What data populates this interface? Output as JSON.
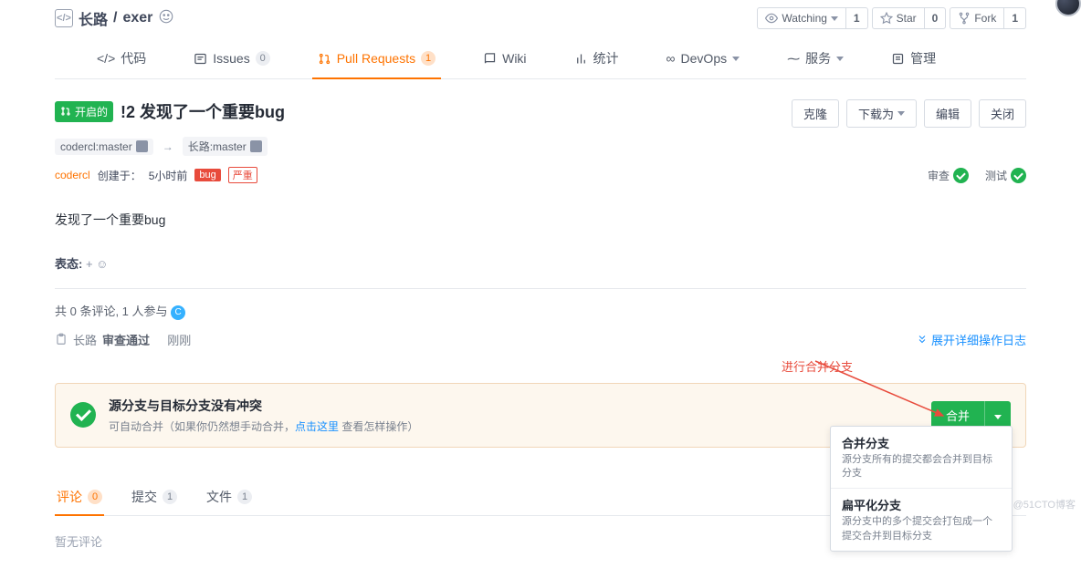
{
  "repo": {
    "owner": "长路",
    "name": "exer"
  },
  "counters": {
    "watch_label": "Watching",
    "watch_count": "1",
    "star_label": "Star",
    "star_count": "0",
    "fork_label": "Fork",
    "fork_count": "1"
  },
  "tabs": {
    "code": "代码",
    "issues": "Issues",
    "issues_count": "0",
    "pr": "Pull Requests",
    "pr_count": "1",
    "wiki": "Wiki",
    "stats": "统计",
    "devops": "DevOps",
    "service": "服务",
    "manage": "管理"
  },
  "pr": {
    "state": "开启的",
    "number": "!2",
    "title": "发现了一个重要bug",
    "source_branch": "codercl:master",
    "target_branch": "长路:master",
    "author": "codercl",
    "created_label": "创建于：",
    "created_time": "5小时前",
    "bug_label": "bug",
    "severity": "严重",
    "review_label": "审查",
    "test_label": "测试",
    "description": "发现了一个重要bug"
  },
  "buttons": {
    "clone": "克隆",
    "download": "下载为",
    "edit": "编辑",
    "close": "关闭"
  },
  "emoji": {
    "label": "表态:",
    "plus": "+"
  },
  "summary": {
    "text": "共 0 条评论, 1 人参与"
  },
  "review_log": {
    "user": "长路",
    "status": "审查通过",
    "time": "刚刚",
    "expand": "展开详细操作日志"
  },
  "annotation": "进行合并分支",
  "merge": {
    "title": "源分支与目标分支没有冲突",
    "sub_pre": "可自动合并（如果你仍然想手动合并，",
    "link": "点击这里",
    "sub_post": " 查看怎样操作）",
    "button": "合并",
    "options": [
      {
        "title": "合并分支",
        "desc": "源分支所有的提交都会合并到目标分支"
      },
      {
        "title": "扁平化分支",
        "desc": "源分支中的多个提交会打包成一个提交合并到目标分支"
      }
    ]
  },
  "subtabs": {
    "comments": "评论",
    "comments_count": "0",
    "commits": "提交",
    "commits_count": "1",
    "files": "文件",
    "files_count": "1"
  },
  "no_comments": "暂无评论",
  "watermark": "@51CTO博客"
}
